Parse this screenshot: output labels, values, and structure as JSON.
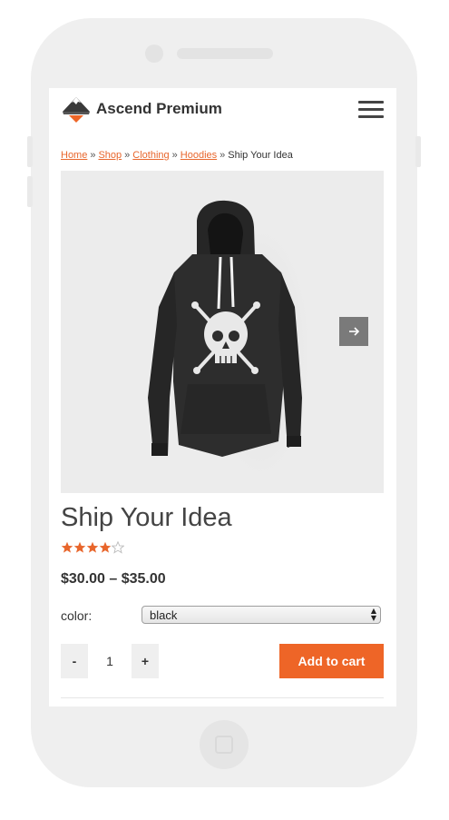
{
  "header": {
    "brand": "Ascend Premium",
    "logo_icon": "mountain-logo-icon",
    "menu_icon": "hamburger-menu-icon"
  },
  "breadcrumb": {
    "links": [
      "Home",
      "Shop",
      "Clothing",
      "Hoodies"
    ],
    "separator": "»",
    "current": "Ship Your Idea"
  },
  "product": {
    "title": "Ship Your Idea",
    "rating": 4,
    "rating_max": 5,
    "price": "$30.00 – $35.00",
    "color_label": "color:",
    "color_value": "black",
    "quantity": "1",
    "qty_minus": "-",
    "qty_plus": "+",
    "add_to_cart": "Add to cart",
    "image_icon": "hoodie-product-image",
    "next_icon": "arrow-right-icon"
  },
  "colors": {
    "accent": "#ee6527",
    "link": "#e8662c",
    "star": "#e8662c"
  }
}
